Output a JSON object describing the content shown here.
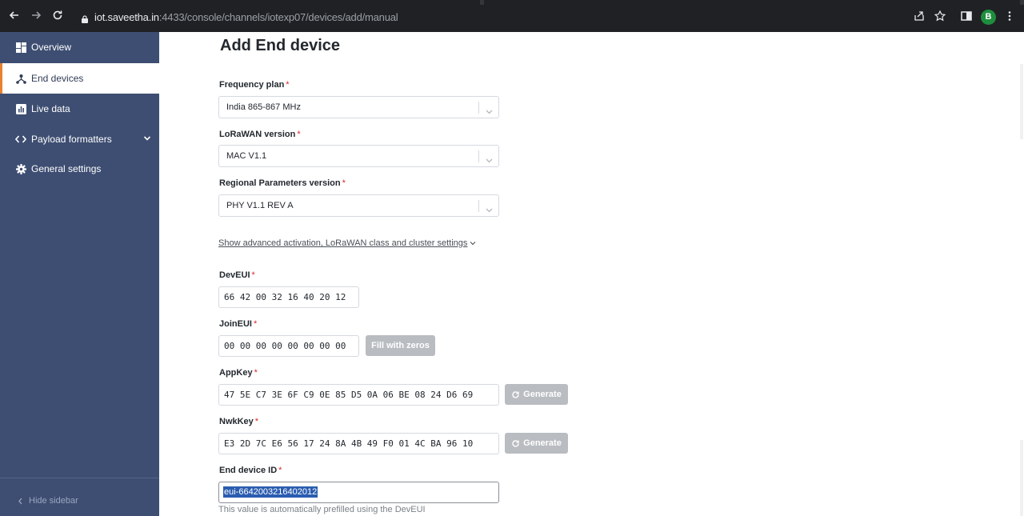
{
  "browser": {
    "url_host": "iot.saveetha.in",
    "url_path": ":4433/console/channels/iotexp07/devices/add/manual",
    "profile_initial": "B"
  },
  "sidebar": {
    "items": [
      {
        "label": "Overview",
        "icon": "dashboard-icon"
      },
      {
        "label": "End devices",
        "icon": "devices-icon"
      },
      {
        "label": "Live data",
        "icon": "chart-icon"
      },
      {
        "label": "Payload formatters",
        "icon": "code-icon"
      },
      {
        "label": "General settings",
        "icon": "gear-icon"
      }
    ],
    "hide_label": "Hide sidebar"
  },
  "page": {
    "title": "Add End device",
    "frequency_plan": {
      "label": "Frequency plan",
      "value": "India 865-867 MHz"
    },
    "lorawan_version": {
      "label": "LoRaWAN version",
      "value": "MAC V1.1"
    },
    "regional_params": {
      "label": "Regional Parameters version",
      "value": "PHY V1.1 REV A"
    },
    "advanced_link": "Show advanced activation, LoRaWAN class and cluster settings",
    "dev_eui": {
      "label": "DevEUI",
      "value": "66 42 00 32 16 40 20 12"
    },
    "join_eui": {
      "label": "JoinEUI",
      "value": "00 00 00 00 00 00 00 00",
      "button": "Fill with zeros"
    },
    "app_key": {
      "label": "AppKey",
      "value": "47 5E C7 3E 6F C9 0E 85 D5 0A 06 BE 08 24 D6 69",
      "button": "Generate"
    },
    "nwk_key": {
      "label": "NwkKey",
      "value": "E3 2D 7C E6 56 17 24 8A 4B 49 F0 01 4C BA 96 10",
      "button": "Generate"
    },
    "end_device_id": {
      "label": "End device ID",
      "value": "eui-6642003216402012",
      "hint": "This value is automatically prefilled using the DevEUI"
    },
    "required_mark": "*"
  },
  "colors": {
    "sidebar_bg": "#3e4e72",
    "active_accent": "#e8812f",
    "required": "#db2828",
    "disabled_button": "#b9bcc1",
    "selection": "#2a5db0"
  }
}
